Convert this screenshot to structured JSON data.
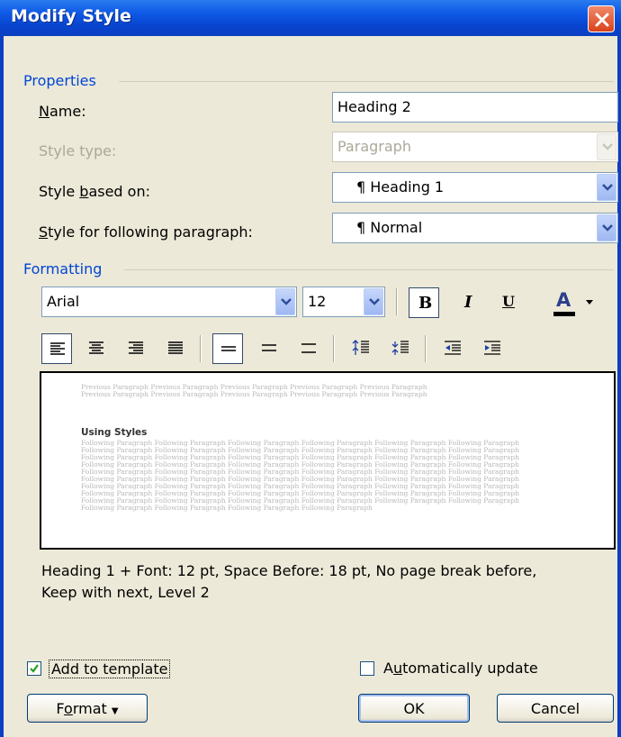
{
  "window": {
    "title": "Modify Style"
  },
  "properties": {
    "group_label": "Properties",
    "name_label": "Name:",
    "name_value": "Heading 2",
    "style_type_label": "Style type:",
    "style_type_value": "Paragraph",
    "based_on_label": "Style based on:",
    "based_on_value": "¶ Heading 1",
    "following_label": "Style for following paragraph:",
    "following_value": "¶ Normal"
  },
  "formatting": {
    "group_label": "Formatting",
    "font": "Arial",
    "size": "12",
    "bold_label": "B",
    "italic_label": "I",
    "underline_label": "U",
    "font_color_label": "A"
  },
  "preview": {
    "previous_lines": [
      "Previous Paragraph Previous Paragraph Previous Paragraph Previous Paragraph Previous Paragraph",
      "Previous Paragraph Previous Paragraph Previous Paragraph Previous Paragraph Previous Paragraph"
    ],
    "heading": "Using Styles",
    "following_lines": [
      "Following Paragraph Following Paragraph Following Paragraph Following Paragraph Following Paragraph Following Paragraph",
      "Following Paragraph Following Paragraph Following Paragraph Following Paragraph Following Paragraph Following Paragraph",
      "Following Paragraph Following Paragraph Following Paragraph Following Paragraph Following Paragraph Following Paragraph",
      "Following Paragraph Following Paragraph Following Paragraph Following Paragraph Following Paragraph Following Paragraph",
      "Following Paragraph Following Paragraph Following Paragraph Following Paragraph Following Paragraph Following Paragraph",
      "Following Paragraph Following Paragraph Following Paragraph Following Paragraph Following Paragraph Following Paragraph",
      "Following Paragraph Following Paragraph Following Paragraph Following Paragraph Following Paragraph Following Paragraph",
      "Following Paragraph Following Paragraph Following Paragraph Following Paragraph Following Paragraph Following Paragraph",
      "Following Paragraph Following Paragraph Following Paragraph Following Paragraph Following Paragraph Following Paragraph",
      "Following Paragraph Following Paragraph Following Paragraph Following Paragraph"
    ]
  },
  "description": {
    "line1": "Heading 1 + Font: 12 pt, Space Before:  18 pt, No page break before,",
    "line2": "Keep with next, Level 2"
  },
  "options": {
    "add_to_template_label": "Add to template",
    "add_to_template_checked": true,
    "auto_update_label": "Automatically update",
    "auto_update_checked": false
  },
  "buttons": {
    "format": "Format",
    "ok": "OK",
    "cancel": "Cancel"
  },
  "colors": {
    "title_bar": "#0a3fc4",
    "dialog_bg": "#ece9d8",
    "group_label": "#0046d5",
    "close_button": "#d8421a",
    "font_color_bar": "#000000"
  },
  "icons": [
    "close-icon",
    "dropdown-arrow-icon",
    "bold-icon",
    "italic-icon",
    "underline-icon",
    "font-color-icon",
    "align-left-icon",
    "align-center-icon",
    "align-right-icon",
    "justify-icon",
    "single-spacing-icon",
    "one-half-spacing-icon",
    "double-spacing-icon",
    "space-before-icon",
    "space-after-icon",
    "decrease-indent-icon",
    "increase-indent-icon",
    "checkmark-icon"
  ]
}
